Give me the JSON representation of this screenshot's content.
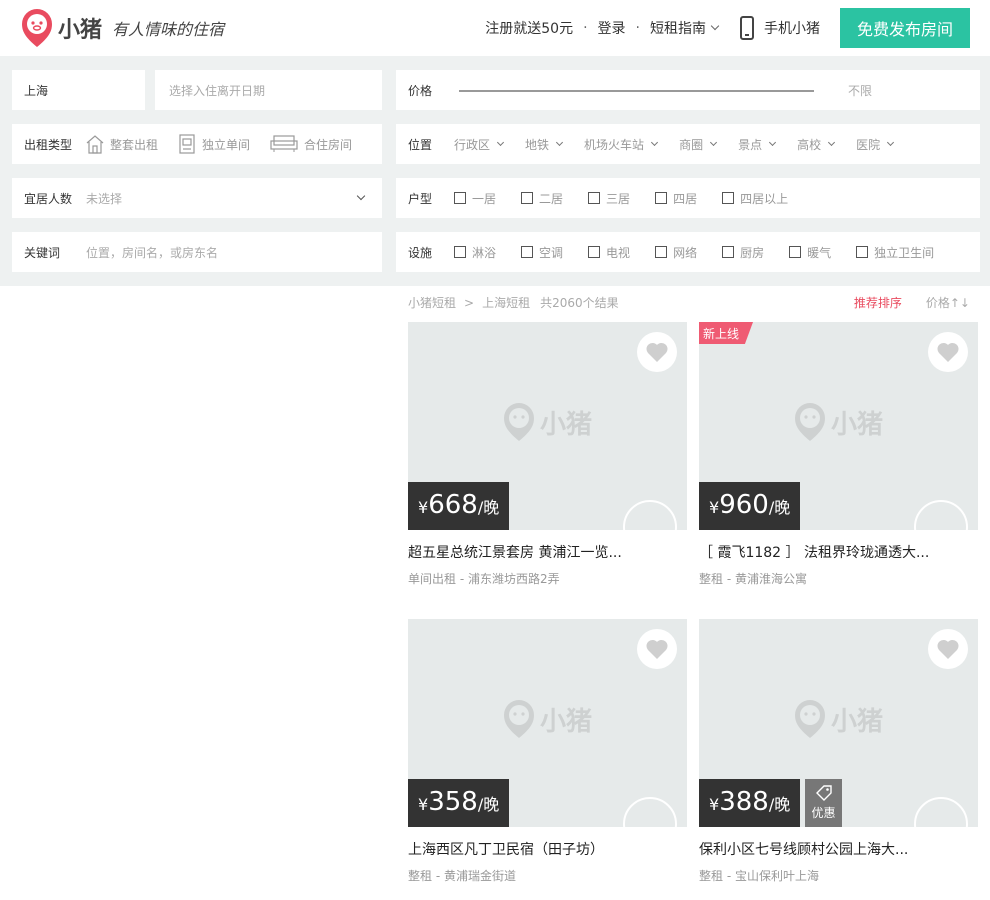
{
  "header": {
    "brand": "小猪",
    "slogan": "有人情味的住宿",
    "nav": {
      "register": "注册就送50元",
      "dot1": "·",
      "login": "登录",
      "dot2": "·",
      "guide": "短租指南",
      "mobile": "手机小猪",
      "publish": "免费发布房间"
    }
  },
  "filters": {
    "city": "上海",
    "date_placeholder": "选择入住离开日期",
    "price_label": "价格",
    "price_value": "不限",
    "rent_type_label": "出租类型",
    "rent_types": [
      "整套出租",
      "独立单间",
      "合住房间"
    ],
    "location_label": "位置",
    "location_options": [
      "行政区",
      "地铁",
      "机场火车站",
      "商圈",
      "景点",
      "高校",
      "医院"
    ],
    "guests_label": "宜居人数",
    "guests_value": "未选择",
    "layout_label": "户型",
    "layout_options": [
      "一居",
      "二居",
      "三居",
      "四居",
      "四居以上"
    ],
    "keyword_label": "关键词",
    "keyword_placeholder": "位置，房间名，或房东名",
    "facility_label": "设施",
    "facility_options": [
      "淋浴",
      "空调",
      "电视",
      "网络",
      "厨房",
      "暖气",
      "独立卫生间"
    ]
  },
  "results": {
    "crumb1": "小猪短租",
    "crumb_sep": ">",
    "crumb2": "上海短租",
    "count": "共2060个结果",
    "sort_recommend": "推荐排序",
    "sort_price": "价格↑↓"
  },
  "listings": [
    {
      "currency": "¥",
      "price": "668",
      "unit": "/晚",
      "title": "超五星总统江景套房 黄浦江一览...",
      "subtitle": "单间出租 - 浦东潍坊西路2弄",
      "badge": "",
      "promo": "",
      "watermark": "小猪"
    },
    {
      "currency": "¥",
      "price": "960",
      "unit": "/晚",
      "title": "［ 霞飞1182 ］ 法租界玲珑通透大...",
      "subtitle": "整租 - 黄浦淮海公寓",
      "badge": "新上线",
      "promo": "",
      "watermark": "小猪"
    },
    {
      "currency": "¥",
      "price": "358",
      "unit": "/晚",
      "title": "上海西区凡丁卫民宿（田子坊）",
      "subtitle": "整租 - 黄浦瑞金街道",
      "badge": "",
      "promo": "",
      "watermark": "小猪"
    },
    {
      "currency": "¥",
      "price": "388",
      "unit": "/晚",
      "title": "保利小区七号线顾村公园上海大...",
      "subtitle": "整租 - 宝山保利叶上海",
      "badge": "",
      "promo": "优惠",
      "watermark": "小猪"
    }
  ],
  "colors": {
    "accent": "#2bc3a2",
    "brand": "#e94b5f",
    "badge": "#ef5b73"
  }
}
